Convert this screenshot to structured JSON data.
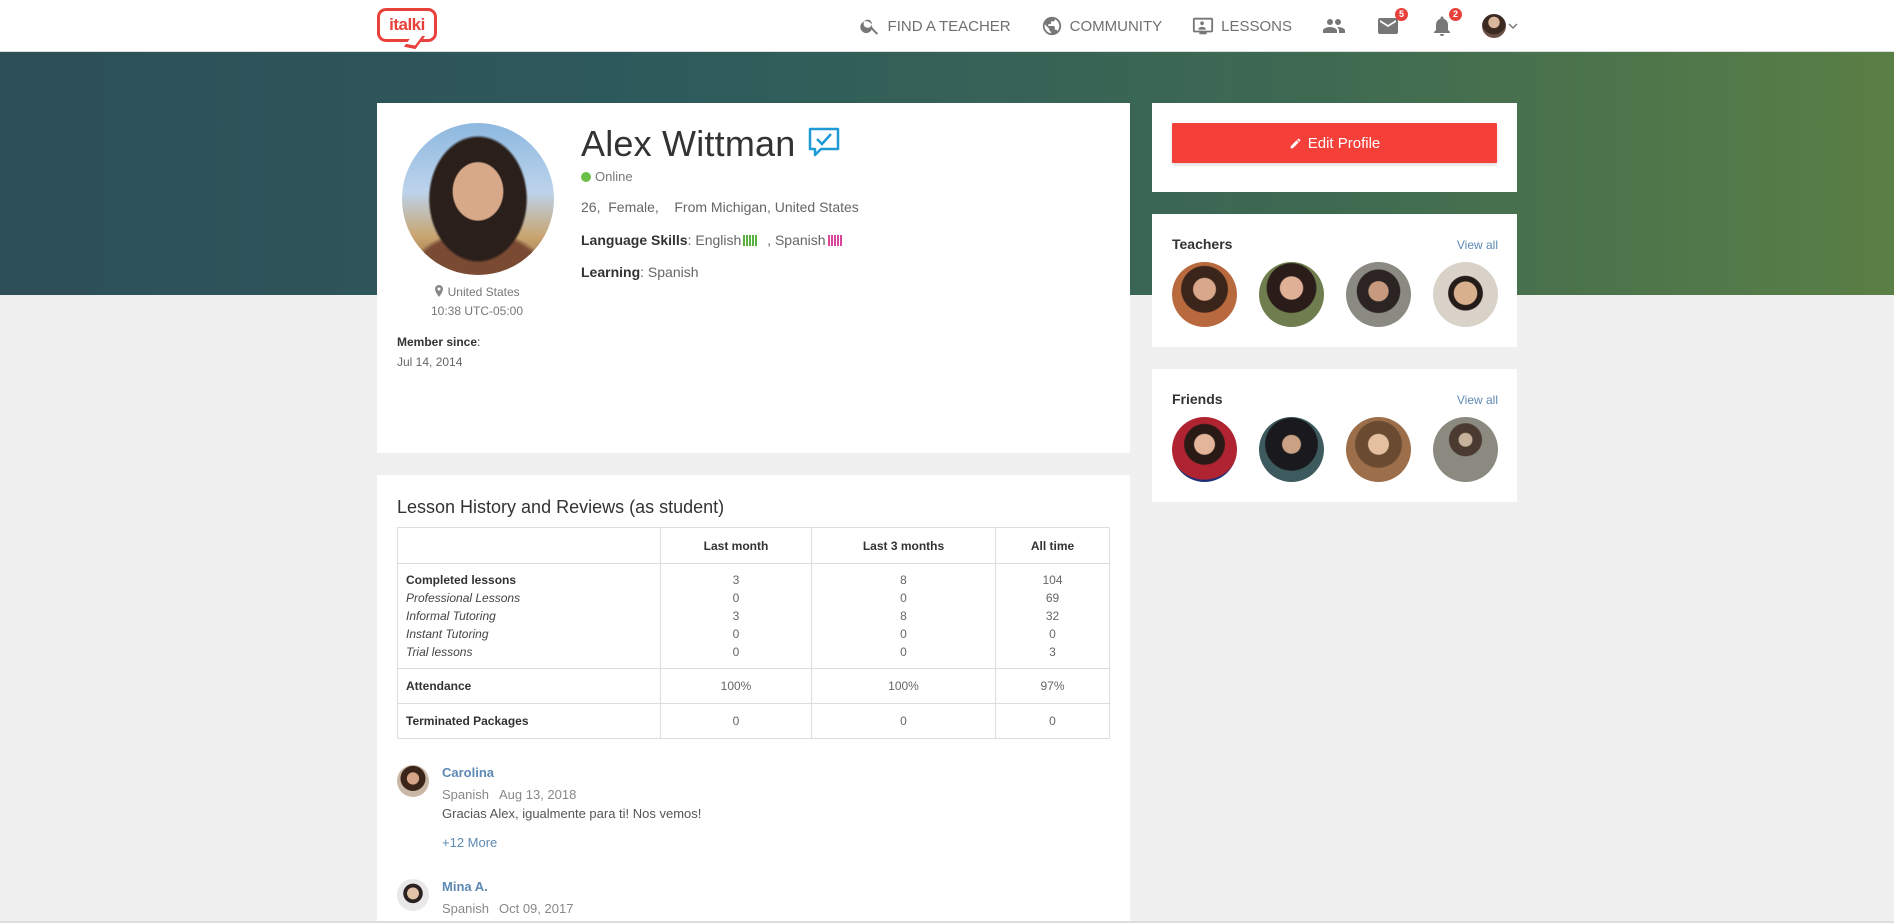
{
  "header": {
    "logo": "italki",
    "nav": [
      {
        "label": "FIND A TEACHER",
        "icon": "search-icon"
      },
      {
        "label": "COMMUNITY",
        "icon": "globe-icon"
      },
      {
        "label": "LESSONS",
        "icon": "lessons-icon"
      }
    ],
    "messages_badge": "5",
    "notifications_badge": "2"
  },
  "profile": {
    "name": "Alex Wittman",
    "status": "Online",
    "info": "26,  Female,    From Michigan, United States",
    "skills_label": "Language Skills",
    "skill_1": "English",
    "skill_sep": " , ",
    "skill_2": "Spanish",
    "learning_label": "Learning",
    "learning_value": "Spanish",
    "location": "United States",
    "local_time": "10:38 UTC-05:00",
    "member_since_label": "Member since",
    "member_since_date": "Jul 14, 2014"
  },
  "sidebar": {
    "edit_profile": "Edit Profile",
    "teachers_title": "Teachers",
    "friends_title": "Friends",
    "view_all": "View all",
    "colors": {
      "accent": "#f5403a",
      "link": "#5d89b4"
    }
  },
  "history": {
    "title": "Lesson History and Reviews (as student)",
    "columns": [
      "",
      "Last month",
      "Last 3 months",
      "All time"
    ],
    "lesson_rows": [
      {
        "label": "Completed lessons",
        "last_month": "3",
        "last_3": "8",
        "all_time": "104"
      },
      {
        "label": "Professional Lessons",
        "last_month": "0",
        "last_3": "0",
        "all_time": "69"
      },
      {
        "label": "Informal Tutoring",
        "last_month": "3",
        "last_3": "8",
        "all_time": "32"
      },
      {
        "label": "Instant Tutoring",
        "last_month": "0",
        "last_3": "0",
        "all_time": "0"
      },
      {
        "label": "Trial lessons",
        "last_month": "0",
        "last_3": "0",
        "all_time": "3"
      }
    ],
    "attendance": {
      "label": "Attendance",
      "last_month": "100%",
      "last_3": "100%",
      "all_time": "97%"
    },
    "terminated": {
      "label": "Terminated Packages",
      "last_month": "0",
      "last_3": "0",
      "all_time": "0"
    },
    "reviews": [
      {
        "name": "Carolina",
        "language": "Spanish",
        "date": "Aug 13, 2018",
        "text": "Gracias Alex, igualmente para ti! Nos vemos!",
        "more": "+12 More"
      },
      {
        "name": "Mina A.",
        "language": "Spanish",
        "date": "Oct 09, 2017"
      }
    ]
  }
}
